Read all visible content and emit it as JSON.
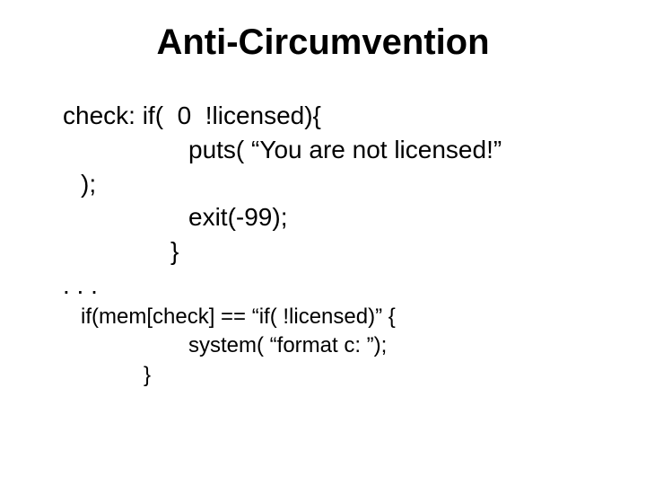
{
  "title": "Anti-Circumvention",
  "code": {
    "l1": "check: if(  0  !licensed){",
    "l2": "puts( “You are not licensed!”",
    "l3": ");",
    "l4": "exit(-99);",
    "l5": "}",
    "l6": ". . .",
    "l7": "if(mem[check] == “if( !licensed)” {",
    "l8": "system( “format c: ”);",
    "l9": "}"
  }
}
